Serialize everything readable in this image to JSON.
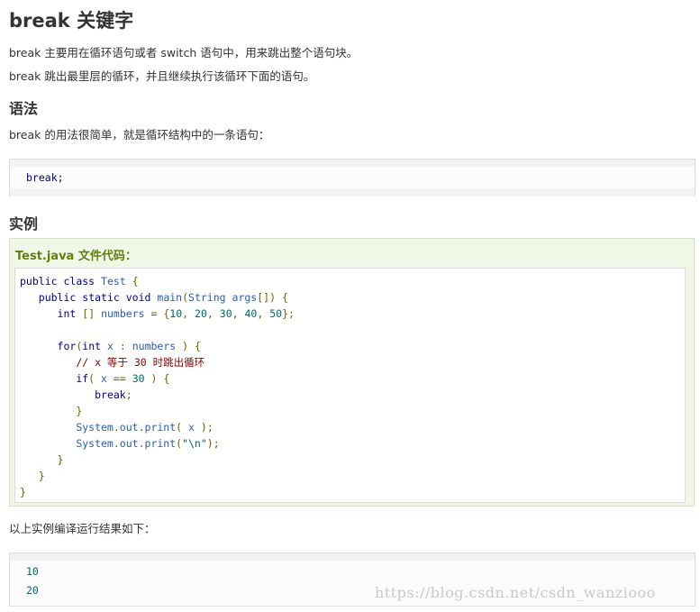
{
  "title": "break 关键字",
  "intro": [
    "break 主要用在循环语句或者 switch 语句中，用来跳出整个语句块。",
    "break 跳出最里层的循环，并且继续执行该循环下面的语句。"
  ],
  "syntax": {
    "heading": "语法",
    "desc": "break 的用法很简单，就是循环结构中的一条语句：",
    "code": "break;"
  },
  "example": {
    "heading": "实例",
    "file_title": "Test.java 文件代码：",
    "lines": [
      "public class Test {",
      "   public static void main(String args[]) {",
      "      int [] numbers = {10, 20, 30, 40, 50};",
      "",
      "      for(int x : numbers ) {",
      "         // x 等于 30 时跳出循环",
      "         if( x == 30 ) {",
      "            break;",
      "         }",
      "         System.out.print( x );",
      "         System.out.print(\"\\n\");",
      "      }",
      "   }",
      "}"
    ]
  },
  "result": {
    "desc": "以上实例编译运行结果如下：",
    "output": [
      "10",
      "20"
    ]
  },
  "watermark": "https://blog.csdn.net/csdn_wanziooo",
  "colors": {
    "keyword": "#000088",
    "function": "#2a5db0",
    "literal": "#006666",
    "comment": "#880000",
    "example_title": "#617f10"
  }
}
